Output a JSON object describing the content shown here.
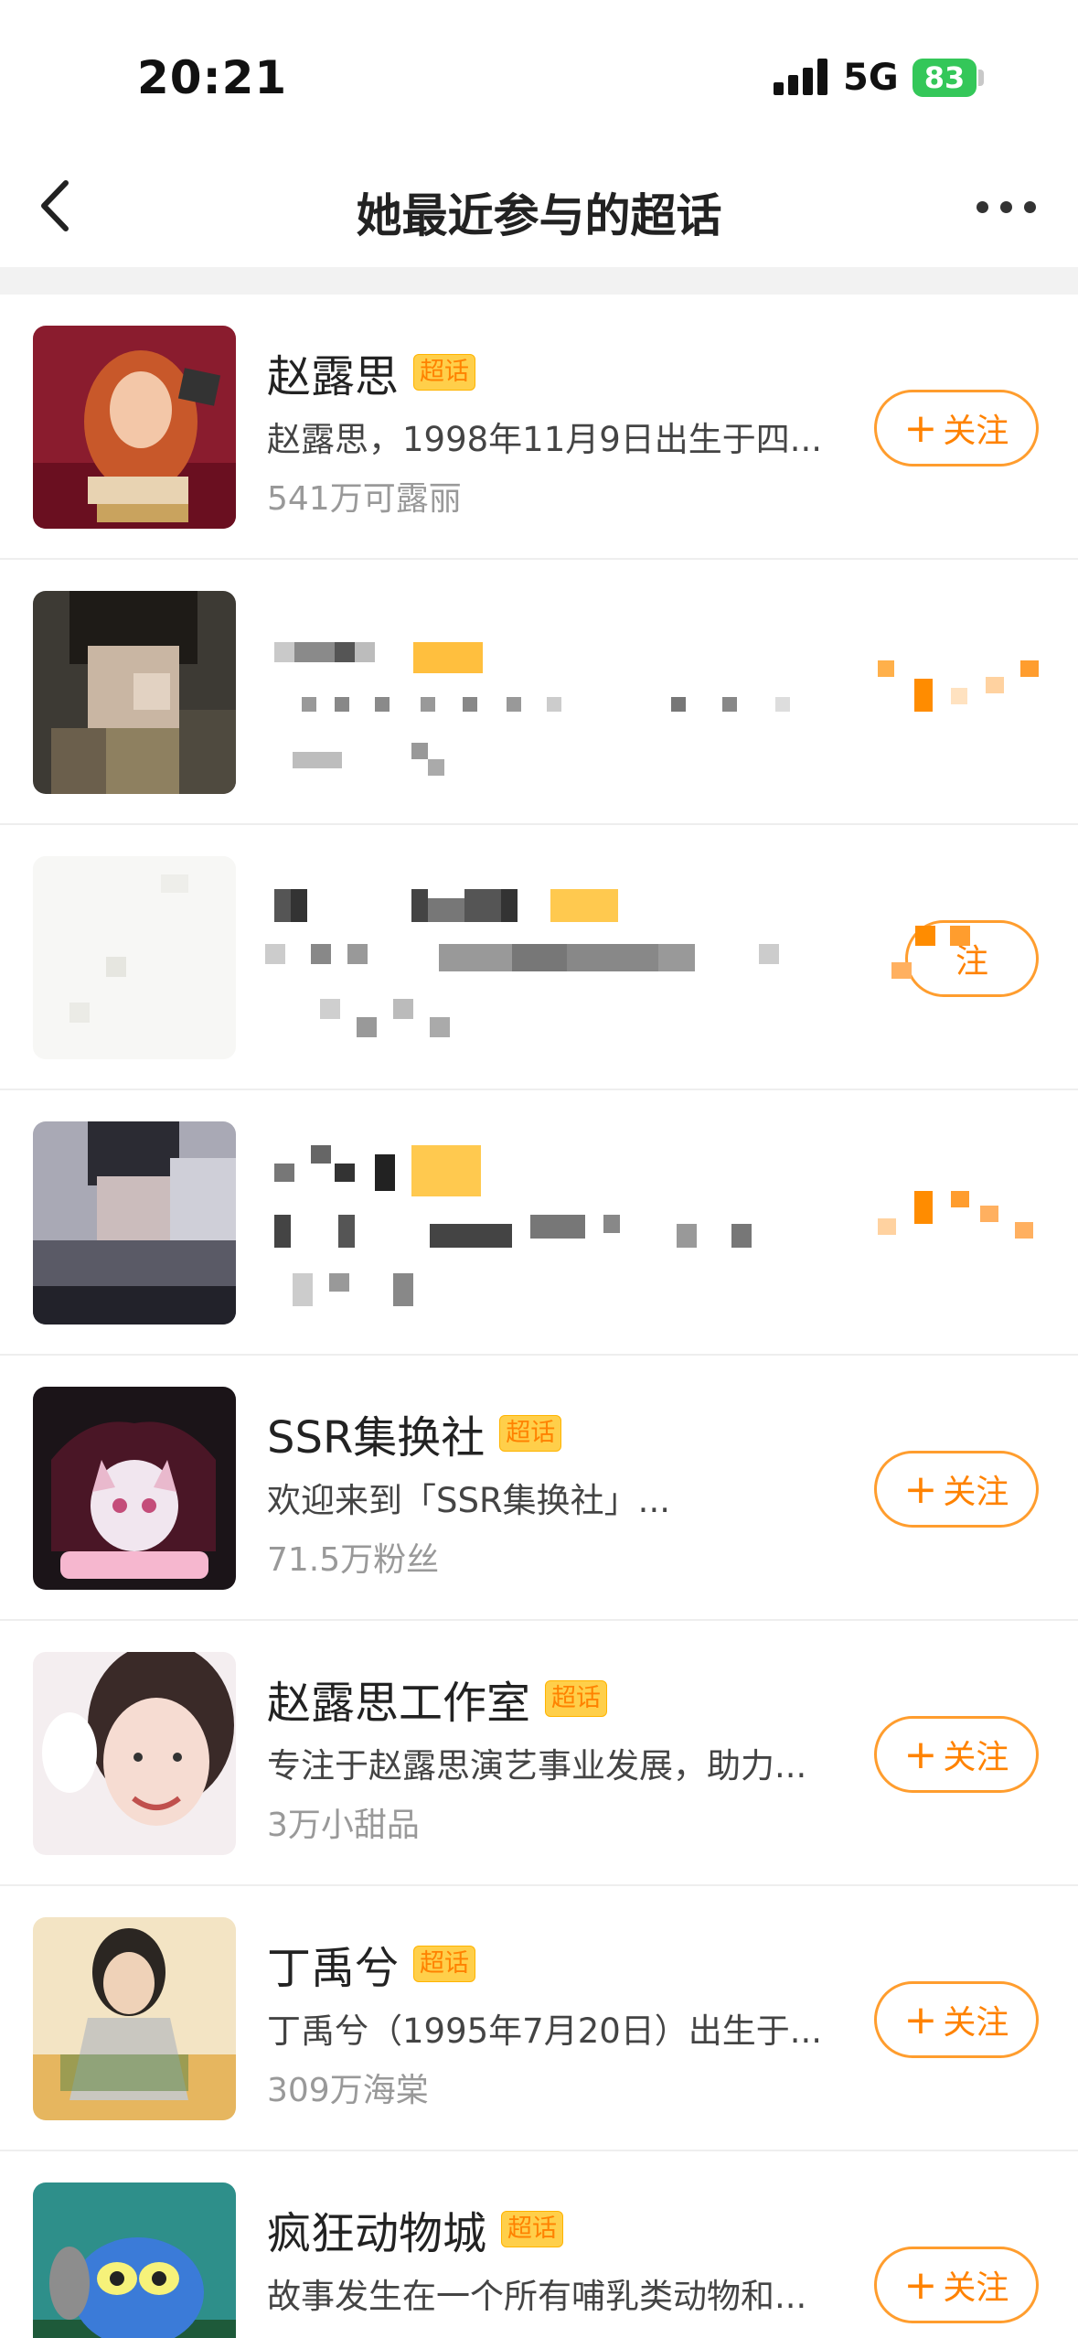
{
  "status_bar": {
    "time": "20:21",
    "network": "5G",
    "battery": "83",
    "icons": [
      "signal-icon",
      "battery-icon",
      "charging-icon"
    ]
  },
  "nav": {
    "title": "她最近参与的超话",
    "back_icon": "chevron-left-icon",
    "more_icon": "more-dots-icon"
  },
  "colors": {
    "accent": "#ff8200",
    "follow_border": "#ff9d2e",
    "badge_bg": "#ffcf4a",
    "divider": "#f2f2f2"
  },
  "follow_label": "关注",
  "badge_label": "超话",
  "topics": [
    {
      "name": "赵露思",
      "badge": "超话",
      "desc": "赵露思，1998年11月9日出生于四...",
      "fans": "541万可露丽",
      "follow": "关注",
      "redacted": false
    },
    {
      "name": "",
      "badge": "",
      "desc": "",
      "fans": "",
      "follow": "",
      "redacted": true
    },
    {
      "name": "",
      "badge": "",
      "desc": "",
      "fans": "",
      "follow": "注",
      "redacted": true
    },
    {
      "name": "",
      "badge": "",
      "desc": "",
      "fans": "",
      "follow": "",
      "redacted": true
    },
    {
      "name": "SSR集换社",
      "badge": "超话",
      "desc": "欢迎来到「SSR集换社」...",
      "fans": "71.5万粉丝",
      "follow": "关注",
      "redacted": false
    },
    {
      "name": "赵露思工作室",
      "badge": "超话",
      "desc": "专注于赵露思演艺事业发展，助力...",
      "fans": "3万小甜品",
      "follow": "关注",
      "redacted": false
    },
    {
      "name": "丁禹兮",
      "badge": "超话",
      "desc": "丁禹兮（1995年7月20日）出生于...",
      "fans": "309万海棠",
      "follow": "关注",
      "redacted": false
    },
    {
      "name": "疯狂动物城",
      "badge": "超话",
      "desc": "故事发生在一个所有哺乳类动物和...",
      "fans": "",
      "follow": "关注",
      "redacted": false
    }
  ]
}
